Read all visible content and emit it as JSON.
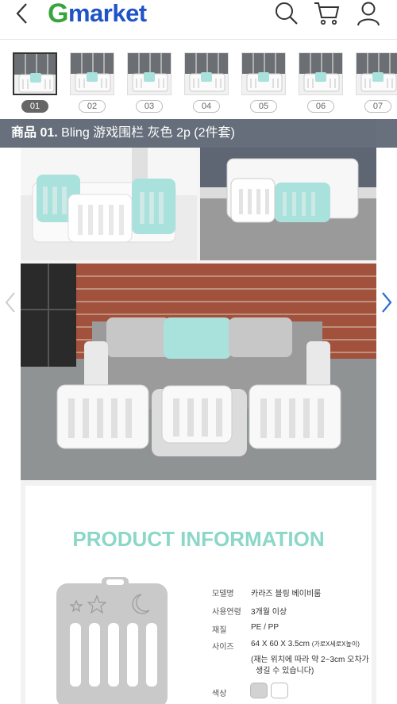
{
  "header": {
    "logo_g": "G",
    "logo_rest": "market",
    "icons": [
      "back-icon",
      "search-icon",
      "cart-icon",
      "user-icon"
    ]
  },
  "thumbnails": [
    {
      "num": "01",
      "active": true
    },
    {
      "num": "02",
      "active": false
    },
    {
      "num": "03",
      "active": false
    },
    {
      "num": "04",
      "active": false
    },
    {
      "num": "05",
      "active": false
    },
    {
      "num": "06",
      "active": false
    },
    {
      "num": "07",
      "active": false
    }
  ],
  "caption": {
    "prefix": "商品 01.",
    "title": " Bling 游戏围栏 灰色 2p (2件套)"
  },
  "info": {
    "title": "PRODUCT INFORMATION",
    "specs": [
      {
        "label": "모델명",
        "value": "카라즈 블링 베이비룸"
      },
      {
        "label": "사용연령",
        "value": "3개월 이상"
      },
      {
        "label": "재질",
        "value": "PE / PP"
      },
      {
        "label": "사이즈",
        "value": "64 X 60 X 3.5cm",
        "note": "(가로X세로X높이)"
      }
    ],
    "size_note_1": "(재는 위치에 따라 약 2~3cm 오차가",
    "size_note_2": "생길 수 있습니다)",
    "color_label": "색상",
    "colors": [
      "#d2d2d2",
      "#ffffff"
    ]
  }
}
